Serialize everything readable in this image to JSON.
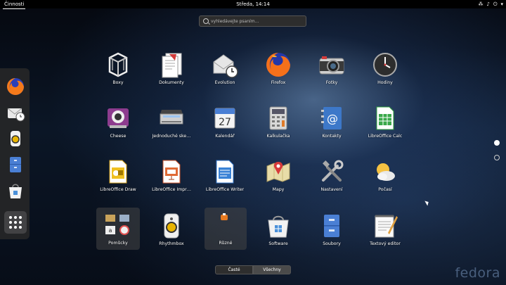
{
  "topbar": {
    "activities_label": "Činnosti",
    "clock": "Středa, 14:14",
    "network_icon": "⁂",
    "volume_icon": "♪",
    "power_icon": "⏻",
    "menu_icon": "▾"
  },
  "search": {
    "placeholder": "vyhledávejte psaním…"
  },
  "dash": {
    "items": [
      "firefox-icon",
      "evolution-icon",
      "rhythmbox-icon",
      "files-icon",
      "software-icon"
    ],
    "show_apps": "apps-grid-icon"
  },
  "apps": [
    {
      "label": "Boxy",
      "icon": "boxes-icon"
    },
    {
      "label": "Dokumenty",
      "icon": "documents-icon"
    },
    {
      "label": "Evolution",
      "icon": "evolution-icon"
    },
    {
      "label": "Firefox",
      "icon": "firefox-icon"
    },
    {
      "label": "Fotky",
      "icon": "photos-icon"
    },
    {
      "label": "Hodiny",
      "icon": "clocks-icon"
    },
    {
      "label": "Cheese",
      "icon": "cheese-icon"
    },
    {
      "label": "Jednoduché ske…",
      "icon": "scanner-icon"
    },
    {
      "label": "Kalendář",
      "icon": "calendar-icon"
    },
    {
      "label": "Kalkulačka",
      "icon": "calculator-icon"
    },
    {
      "label": "Kontakty",
      "icon": "contacts-icon"
    },
    {
      "label": "LibreOffice Calc",
      "icon": "libreoffice-calc-icon"
    },
    {
      "label": "LibreOffice Draw",
      "icon": "libreoffice-draw-icon"
    },
    {
      "label": "LibreOffice Impr…",
      "icon": "libreoffice-impress-icon"
    },
    {
      "label": "LibreOffice Writer",
      "icon": "libreoffice-writer-icon"
    },
    {
      "label": "Mapy",
      "icon": "maps-icon"
    },
    {
      "label": "Nastavení",
      "icon": "settings-icon"
    },
    {
      "label": "Počasí",
      "icon": "weather-icon"
    },
    {
      "label": "Pomůcky",
      "icon": "utilities-folder-icon"
    },
    {
      "label": "Rhythmbox",
      "icon": "rhythmbox-icon"
    },
    {
      "label": "Různé",
      "icon": "sundry-folder-icon"
    },
    {
      "label": "Software",
      "icon": "software-icon"
    },
    {
      "label": "Soubory",
      "icon": "files-icon"
    },
    {
      "label": "Textový editor",
      "icon": "text-editor-icon"
    }
  ],
  "calendar_day": "27",
  "switcher": {
    "frequent": "Časté",
    "all": "Všechny"
  },
  "brand": "fedora"
}
